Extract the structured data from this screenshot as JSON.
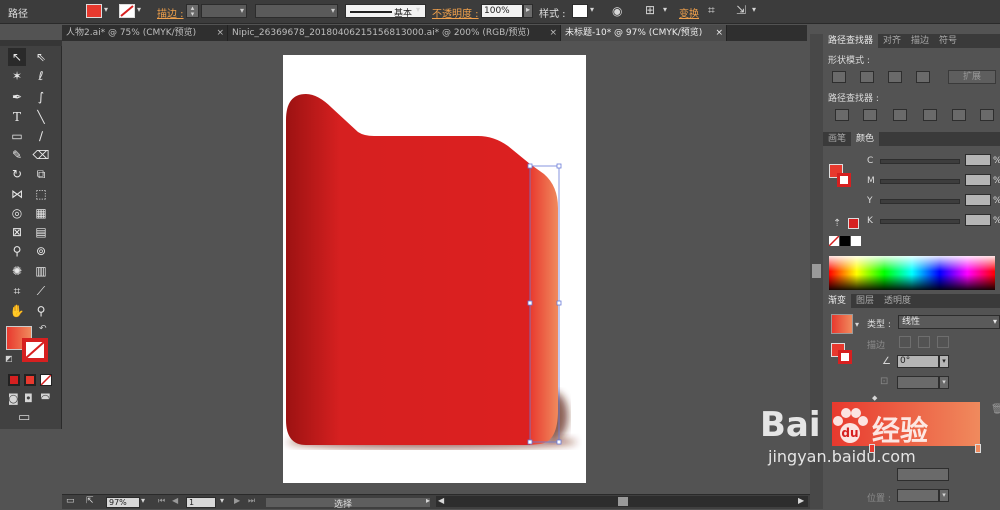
{
  "control_bar": {
    "mode_label": "路径",
    "stroke_label": "描边 :",
    "stroke_style": "基本",
    "opacity_label": "不透明度 :",
    "opacity_value": "100%",
    "style_label": "样式 :",
    "transform_label": "变换"
  },
  "tabs": [
    {
      "label": "人物2.ai* @ 75% (CMYK/预览)",
      "close": "×"
    },
    {
      "label": "Nipic_26369678_20180406215156813000.ai* @ 200% (RGB/预览)",
      "close": "×"
    },
    {
      "label": "未标题-10* @ 97% (CMYK/预览)",
      "close": "×"
    }
  ],
  "pathfinder_panel": {
    "tabs": [
      "路径查找器",
      "对齐",
      "描边",
      "符号"
    ],
    "shape_modes_label": "形状模式 :",
    "expand_label": "扩展",
    "pathfinders_label": "路径查找器 :"
  },
  "color_panel": {
    "tabs": [
      "画笔",
      "颜色"
    ],
    "channels": [
      "C",
      "M",
      "Y",
      "K"
    ],
    "percent": "%"
  },
  "gradient_panel": {
    "tabs": [
      "渐变",
      "图层",
      "透明度"
    ],
    "type_label": "类型 :",
    "type_value": "线性",
    "stroke_label": "描边",
    "angle_value": "0°",
    "location_label": "位置 :"
  },
  "status_bar": {
    "zoom": "97%",
    "page": "1",
    "tool_name": "选择"
  },
  "watermark": {
    "brand": "Bai",
    "brand_paw": "du",
    "brand_cn": "经验",
    "url": "jingyan.baidu.com"
  },
  "colors": {
    "accent_red": "#dc2020",
    "gradient_start": "#e8392e",
    "gradient_end": "#f08a5d"
  }
}
